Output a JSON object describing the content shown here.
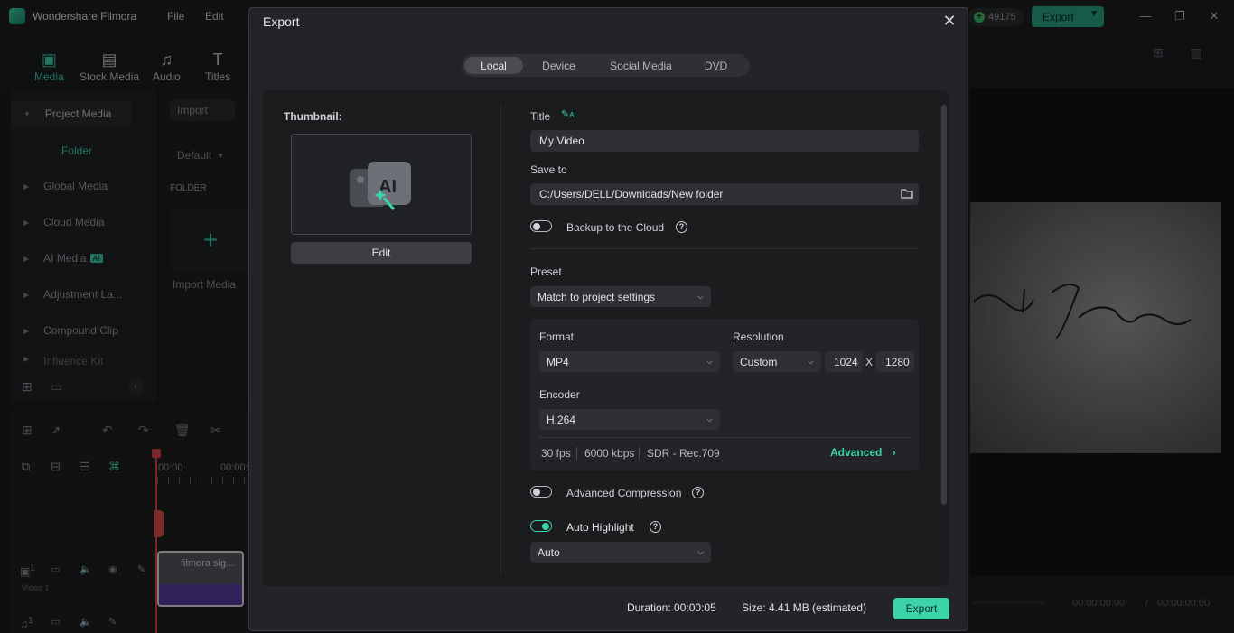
{
  "app": {
    "name": "Wondershare Filmora",
    "menu": [
      "File",
      "Edit"
    ],
    "credits": "49175",
    "export_label": "Export"
  },
  "toolbar": {
    "items": [
      {
        "label": "Media",
        "icon": "media-icon"
      },
      {
        "label": "Stock Media",
        "icon": "stock-media-icon"
      },
      {
        "label": "Audio",
        "icon": "music-note-icon"
      },
      {
        "label": "Titles",
        "icon": "text-t-icon"
      }
    ]
  },
  "left_panel": {
    "project_media": "Project Media",
    "folder": "Folder",
    "items": [
      "Global Media",
      "Cloud Media",
      "AI Media",
      "Adjustment La...",
      "Compound Clip",
      "Influence Kit"
    ],
    "ai_badge": "AI"
  },
  "media_panel": {
    "import_label": "Import",
    "sort_label": "Default",
    "folder_header": "FOLDER",
    "import_media_label": "Import Media"
  },
  "timeline": {
    "time_start": "00:00",
    "time_next": "00:00:",
    "clip_name": "filmora sig...",
    "track_label": "Video 1",
    "video_track_num": "1",
    "audio_track_num": "1"
  },
  "preview": {
    "timecode_current": "00:00:00:00",
    "timecode_total": "00:00:00:00",
    "separator": "/"
  },
  "export_dialog": {
    "title": "Export",
    "tabs": [
      "Local",
      "Device",
      "Social Media",
      "DVD"
    ],
    "active_tab": "Local",
    "thumbnail_label": "Thumbnail:",
    "thumbnail_badge": "AI",
    "edit_label": "Edit",
    "title_label": "Title",
    "title_ai": "AI",
    "title_value": "My Video",
    "save_to_label": "Save to",
    "save_to_value": "C:/Users/DELL/Downloads/New folder",
    "backup_label": "Backup to the Cloud",
    "backup_enabled": false,
    "preset_label": "Preset",
    "preset_value": "Match to project settings",
    "format_label": "Format",
    "format_value": "MP4",
    "resolution_label": "Resolution",
    "resolution_value": "Custom",
    "res_width": "1024",
    "res_x": "X",
    "res_height": "1280",
    "encoder_label": "Encoder",
    "encoder_value": "H.264",
    "stats": [
      "30 fps",
      "6000 kbps",
      "SDR - Rec.709"
    ],
    "advanced_label": "Advanced",
    "advanced_compression_label": "Advanced Compression",
    "advanced_compression_enabled": false,
    "auto_highlight_label": "Auto Highlight",
    "auto_highlight_enabled": true,
    "auto_highlight_value": "Auto",
    "duration_label": "Duration:",
    "duration_value": "00:00:05",
    "size_label": "Size:",
    "size_value": "4.41 MB (estimated)",
    "export_label": "Export"
  },
  "colors": {
    "accent": "#3cd3a9",
    "dialog_bg": "#232427",
    "content_bg": "#1b1c1e"
  }
}
